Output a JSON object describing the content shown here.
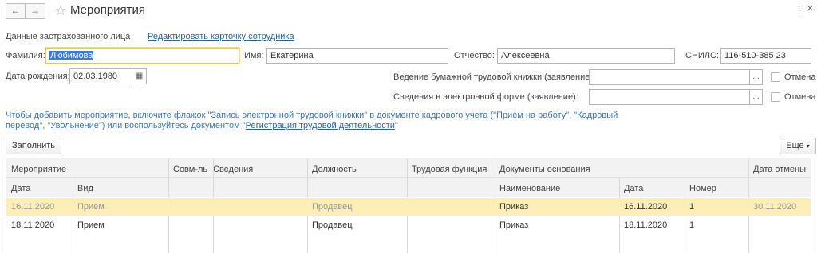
{
  "header": {
    "back_icon": "←",
    "forward_icon": "→",
    "star_icon": "☆",
    "title": "Мероприятия",
    "more_icon": "⋮",
    "close_icon": "×"
  },
  "insured": {
    "section_label": "Данные застрахованного лица",
    "edit_link": "Редактировать карточку сотрудника",
    "surname_label": "Фамилия:",
    "surname_value": "Любимова",
    "name_label": "Имя:",
    "name_value": "Екатерина",
    "patronymic_label": "Отчество:",
    "patronymic_value": "Алексеевна",
    "snils_label": "СНИЛС:",
    "snils_value": "116-510-385 23",
    "birth_label": "Дата рождения:",
    "birth_value": "02.03.1980",
    "calendar_icon": "▦",
    "paper_book_label": "Ведение бумажной трудовой книжки (заявление):",
    "paper_book_value": "",
    "electronic_label": "Сведения в электронной форме (заявление):",
    "electronic_value": "",
    "ellipsis": "...",
    "cancel_label": "Отмена"
  },
  "hint": {
    "text_before": "Чтобы добавить мероприятие, включите флажок \"Запись электронной трудовой книжки\" в документе кадрового учета (\"Прием на работу\", \"Кадровый перевод\", \"Увольнение\") или воспользуйтесь документом \"",
    "link": "Регистрация трудовой деятельности",
    "text_after": "\""
  },
  "toolbar": {
    "fill_label": "Заполнить",
    "more_label": "Еще",
    "more_caret": "▾"
  },
  "table": {
    "headers": {
      "event": "Мероприятие",
      "date": "Дата",
      "kind": "Вид",
      "part_time": "Совм-ль",
      "info": "Сведения",
      "position": "Должность",
      "function": "Трудовая функция",
      "docs": "Документы основания",
      "doc_name": "Наименование",
      "doc_date": "Дата",
      "doc_number": "Номер",
      "cancel_date": "Дата отмены"
    },
    "rows": [
      {
        "date": "16.11.2020",
        "kind": "Прием",
        "position": "Продавец",
        "doc_name": "Приказ",
        "doc_date": "16.11.2020",
        "doc_number": "1",
        "cancel_date": "30.11.2020"
      },
      {
        "date": "18.11.2020",
        "kind": "Прием",
        "position": "Продавец",
        "doc_name": "Приказ",
        "doc_date": "18.11.2020",
        "doc_number": "1",
        "cancel_date": ""
      }
    ]
  },
  "colors": {
    "accent_link": "#2a62a8",
    "hint_text": "#3a76b4",
    "selected_row": "#fbeeb6",
    "focus_border": "#f2c14b",
    "selection": "#3a7bd5"
  }
}
